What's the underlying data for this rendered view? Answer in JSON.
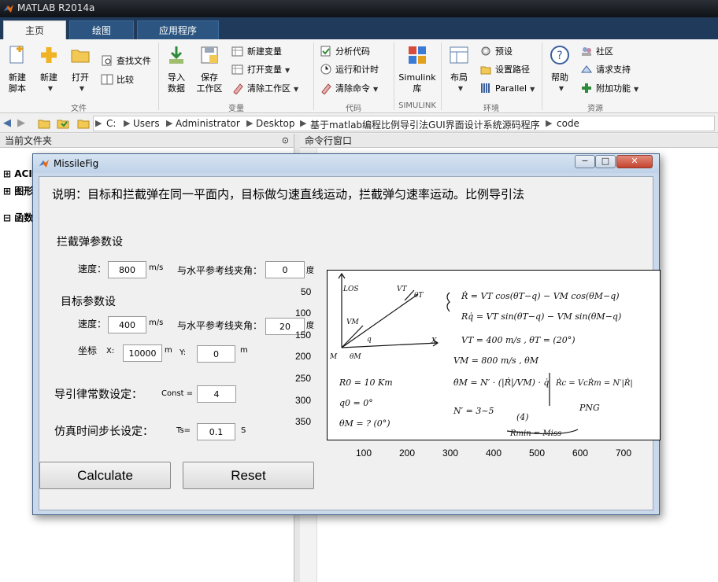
{
  "app": {
    "title": "MATLAB R2014a"
  },
  "tabs": [
    "主页",
    "绘图",
    "应用程序"
  ],
  "ribbon": {
    "file_group": {
      "label": "文件",
      "new_script": "新建\n脚本",
      "new": "新建",
      "open": "打开",
      "find_files": "查找文件",
      "compare": "比较"
    },
    "variable_group": {
      "label": "变量",
      "import": "导入\n数据",
      "save": "保存\n工作区",
      "new_var": "新建变量",
      "open_var": "打开变量",
      "clear_ws": "清除工作区"
    },
    "code_group": {
      "label": "代码",
      "analyze": "分析代码",
      "run_time": "运行和计时",
      "clear_cmd": "清除命令"
    },
    "simulink_group": {
      "label": "SIMULINK",
      "simulink": "Simulink\n库"
    },
    "env_group": {
      "label": "环境",
      "layout": "布局",
      "prefs": "预设",
      "set_path": "设置路径",
      "parallel": "Parallel"
    },
    "resources_group": {
      "label": "资源",
      "help": "帮助",
      "community": "社区",
      "support": "请求支持",
      "addons": "附加功能"
    }
  },
  "address": {
    "crumbs": [
      "C:",
      "Users",
      "Administrator",
      "Desktop",
      "基于matlab编程比例导引法GUI界面设计系统源码程序",
      "code"
    ]
  },
  "panels": {
    "current_folder": "当前文件夹",
    "command_window": "命令行窗口",
    "tree": [
      "ACI",
      "图形",
      "函数"
    ]
  },
  "dialog": {
    "title": "MissileFig",
    "minimize": "−",
    "maximize": "□",
    "close": "✕",
    "description": "说明：目标和拦截弹在同一平面内，目标做匀速直线运动，拦截弹匀速率运动。比例导引法",
    "interceptor_header": "拦截弹参数设",
    "speed_label": "速度：",
    "speed_unit": "m/s",
    "angle_label": "与水平参考线夹角：",
    "angle_unit": "度",
    "interceptor_speed": "800",
    "interceptor_angle": "0",
    "target_header": "目标参数设",
    "target_speed": "400",
    "target_angle": "20",
    "coord_label": "坐标",
    "x_label": "X:",
    "y_label": "Y:",
    "m_unit": "m",
    "target_x": "10000",
    "target_y": "0",
    "guidance_label": "导引律常数设定：",
    "const_label": "Const =",
    "const_value": "4",
    "step_label": "仿真时间步长设定：",
    "ts_label": "Ts=",
    "ts_value": "0.1",
    "ts_unit": "S",
    "calculate": "Calculate",
    "reset": "Reset"
  },
  "axes": {
    "y_ticks": [
      "50",
      "100",
      "150",
      "200",
      "250",
      "300",
      "350"
    ],
    "x_ticks": [
      "100",
      "200",
      "300",
      "400",
      "500",
      "600",
      "700"
    ],
    "handwritten": {
      "los": "LOS",
      "vt": "VT",
      "theta_t": "θT",
      "vm": "VM",
      "q": "q",
      "x": "X",
      "m": "M",
      "theta_m": "θM",
      "eq1": "Ṙ = VT cos(θT−q) − VM cos(θM−q)",
      "eq2": "Rq̇ = VT sin(θT−q) − VM sin(θM−q)",
      "eq3": "VT = 400 m/s ,  θT = (20°)",
      "eq4": "VM = 800 m/s ,  θM",
      "eq5": "R0 = 10 Km",
      "eq6": "q0 = 0°",
      "eq7": "θM = ? (0°)",
      "eq8": "θ̇M = N′ · (|Ṙ|/VM) · q̇",
      "eq9": "Ṙc = VcṘm = N′|Ṙ|",
      "eq10": "PNG",
      "eq11": "N′ = 3~5",
      "eq12": "(4)",
      "eq13": "Rmin = Miss"
    }
  }
}
